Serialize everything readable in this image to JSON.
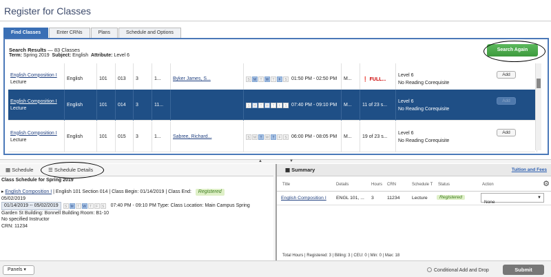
{
  "page": {
    "title": "Register for Classes"
  },
  "tabs": [
    "Find Classes",
    "Enter CRNs",
    "Plans",
    "Schedule and Options"
  ],
  "search": {
    "results_label": "Search Results",
    "results_count": "— 83 Classes",
    "term_label": "Term:",
    "term": "Spring 2019",
    "subject_label": "Subject:",
    "subject": "English",
    "attribute_label": "Attribute:",
    "attribute": "Level 6",
    "again_button": "Search Again"
  },
  "results": [
    {
      "title": "English Composition I",
      "type": "Lecture",
      "subject": "English",
      "course": "101",
      "section": "013",
      "hours": "3",
      "crn": "1...",
      "term": "S...",
      "instructor": "Byker James, S...",
      "days": [
        0,
        1,
        0,
        1,
        0,
        1,
        0
      ],
      "time": "01:50 PM - 02:50 PM",
      "campus": "M...",
      "status": "FULL...",
      "attr1": "Level 6",
      "attr2": "No Reading Corequisite",
      "add": "Add"
    },
    {
      "title": "English Composition I",
      "type": "Lecture",
      "subject": "English",
      "course": "101",
      "section": "014",
      "hours": "3",
      "crn": "11...",
      "term": "S...",
      "instructor": "",
      "days": [
        0,
        1,
        0,
        1,
        0,
        0,
        0
      ],
      "time": "07:40 PM - 09:10 PM",
      "campus": "M...",
      "status": "11 of 23 s...",
      "attr1": "Level 6",
      "attr2": "No Reading Corequisite",
      "add": "Add"
    },
    {
      "title": "English Composition I",
      "type": "Lecture",
      "subject": "English",
      "course": "101",
      "section": "015",
      "hours": "3",
      "crn": "1...",
      "term": "S...",
      "instructor": "Sabree, Richard...",
      "days": [
        0,
        0,
        1,
        0,
        1,
        0,
        0
      ],
      "time": "06:00 PM - 08:05 PM",
      "campus": "M...",
      "status": "19 of 23 s...",
      "attr1": "Level 6",
      "attr2": "No Reading Corequisite",
      "add": "Add"
    }
  ],
  "day_letters": [
    "S",
    "M",
    "T",
    "W",
    "T",
    "F",
    "S"
  ],
  "left_tabs": {
    "schedule": "Schedule",
    "details": "Schedule Details"
  },
  "schedule": {
    "heading": "Class Schedule for Spring 2019",
    "course_link": "English Composition I",
    "course_info": "| English 101 Section 014 | Class Begin: 01/14/2019 | Class End:",
    "end_date": "05/02/2019",
    "registered": "Registered",
    "date_range": "01/14/2019 -- 05/02/2019",
    "meeting": "07:40 PM - 09:10 PM Type: Class Location: Main Campus Spring",
    "building": "Garden St Building: Bonnell Building Room: B1-10",
    "instructor": "No specified Instructor",
    "crn": "CRN: 11234",
    "days": [
      0,
      1,
      0,
      1,
      0,
      0,
      0
    ]
  },
  "summary": {
    "title": "Summary",
    "tuition_link": "Tuition and Fees",
    "columns": [
      "Title",
      "Details",
      "Hours",
      "CRN",
      "Schedule T",
      "Status",
      "Action"
    ],
    "row": {
      "title": "English Composition I",
      "details": "ENGL 101, ...",
      "hours": "3",
      "crn": "11234",
      "type": "Lecture",
      "status": "Registered",
      "action": "None"
    },
    "totals": "Total Hours | Registered: 3 | Billing: 3 | CEU: 0 | Min: 0 | Max: 18"
  },
  "footer": {
    "panels": "Panels",
    "conditional": "Conditional Add and Drop",
    "submit": "Submit"
  },
  "colors": {
    "accent": "#3a6fb5",
    "selected_row": "#1f4f86",
    "go": "#5cb85c"
  }
}
